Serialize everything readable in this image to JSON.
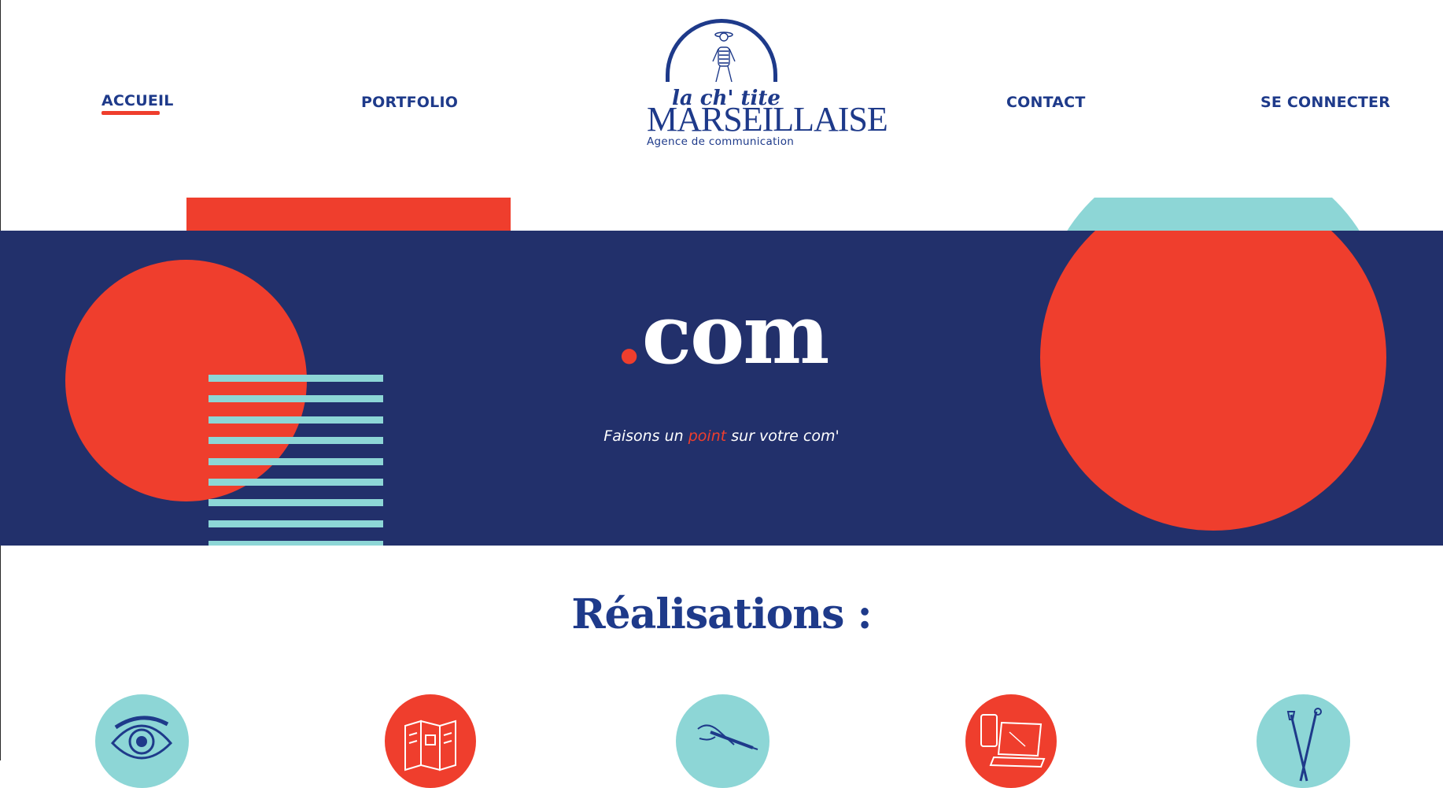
{
  "nav": {
    "accueil": "ACCUEIL",
    "portfolio": "PORTFOLIO",
    "contact": "CONTACT",
    "login": "SE CONNECTER",
    "active": "accueil"
  },
  "logo": {
    "script_text": "la ch' tite",
    "main_text": "MARSEILLAISE",
    "tagline": "Agence de communication"
  },
  "hero": {
    "dot": ".",
    "title": "com",
    "tagline_before": "Faisons un ",
    "tagline_accent": "point",
    "tagline_after": " sur votre com'"
  },
  "section": {
    "title": "Réalisations :"
  },
  "services": [
    {
      "icon": "eye-icon",
      "color": "#8dd6d6"
    },
    {
      "icon": "brochure-icon",
      "color": "#ef3e2d"
    },
    {
      "icon": "hand-pen-icon",
      "color": "#8dd6d6"
    },
    {
      "icon": "devices-icon",
      "color": "#ef3e2d"
    },
    {
      "icon": "brushes-icon",
      "color": "#8dd6d6"
    }
  ],
  "colors": {
    "navy": "#22306b",
    "brand_blue": "#1e3a8a",
    "red": "#ef3e2d",
    "teal": "#8dd6d6"
  }
}
